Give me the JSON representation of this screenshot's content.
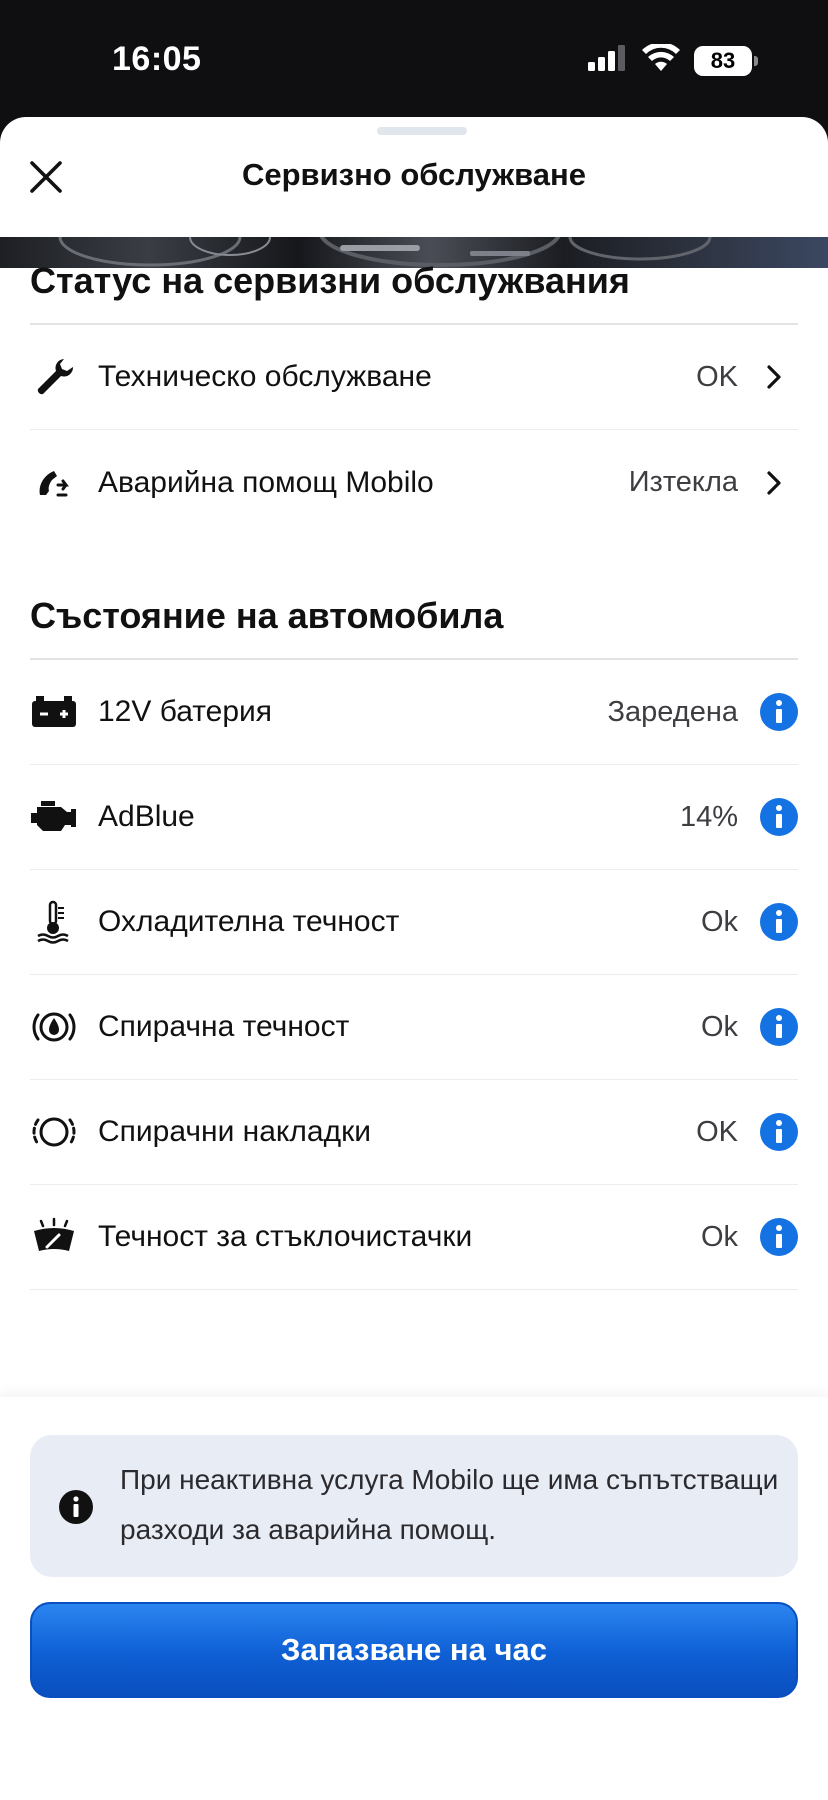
{
  "status_bar": {
    "time": "16:05",
    "battery": "83"
  },
  "header": {
    "title": "Сервизно обслужване",
    "close_icon": "close-icon"
  },
  "service_status": {
    "title": "Статус на сервизни обслужвания",
    "items": [
      {
        "icon": "wrench-icon",
        "label": "Техническо обслужване",
        "value": "OK"
      },
      {
        "icon": "roadside-phone-icon",
        "label": "Аварийна помощ Mobilo",
        "value": "Изтекла"
      }
    ]
  },
  "vehicle_status": {
    "title": "Състояние на автомобила",
    "items": [
      {
        "icon": "battery-icon",
        "label": "12V батерия",
        "value": "Заредена"
      },
      {
        "icon": "engine-icon",
        "label": "AdBlue",
        "value": "14%"
      },
      {
        "icon": "coolant-thermometer-icon",
        "label": "Охладителна течност",
        "value": "Ok"
      },
      {
        "icon": "brake-fluid-icon",
        "label": "Спирачна течност",
        "value": "Ok"
      },
      {
        "icon": "brake-pads-icon",
        "label": "Спирачни накладки",
        "value": "OK"
      },
      {
        "icon": "washer-fluid-icon",
        "label": "Течност за стъклочистачки",
        "value": "Ok"
      }
    ]
  },
  "notice": {
    "text": "При неактивна услуга Mobilo ще има съпътстващи разходи за аварийна помощ."
  },
  "cta": {
    "label": "Запазване на час"
  },
  "colors": {
    "accent": "#1572e3",
    "notice_bg": "#e8ecf4"
  }
}
